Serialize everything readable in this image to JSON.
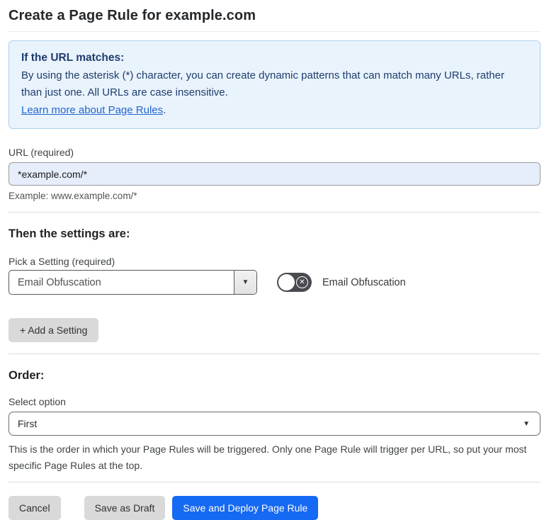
{
  "page": {
    "title": "Create a Page Rule for example.com"
  },
  "url_section": {
    "callout": {
      "heading": "If the URL matches:",
      "body": "By using the asterisk (*) character, you can create dynamic patterns that can match many URLs, rather than just one. All URLs are case insensitive.",
      "link_label": "Learn more about Page Rules",
      "link_suffix": "."
    },
    "url_label": "URL (required)",
    "url_value": "*example.com/*",
    "example_text": "Example: www.example.com/*"
  },
  "settings_section": {
    "heading": "Then the settings are:",
    "pick_label": "Pick a Setting (required)",
    "selected_setting": "Email Obfuscation",
    "toggle_label": "Email Obfuscation",
    "toggle_state": "off",
    "add_setting_label": "+ Add a Setting"
  },
  "order_section": {
    "heading": "Order:",
    "select_label": "Select option",
    "selected_option": "First",
    "help_text": "This is the order in which your Page Rules will be triggered. Only one Page Rule will trigger per URL, so put your most specific Page Rules at the top."
  },
  "footer": {
    "cancel_label": "Cancel",
    "save_draft_label": "Save as Draft",
    "save_deploy_label": "Save and Deploy Page Rule"
  },
  "icons": {
    "dropdown_arrow": "▼",
    "toggle_x": "✕"
  },
  "colors": {
    "callout_bg": "#e9f3fc",
    "callout_border": "#abd0ef",
    "callout_text": "#1f3d6d",
    "link": "#2366cc",
    "url_input_bg": "#e6eefc",
    "primary_button": "#1669f2",
    "gray_button": "#d9d9d9",
    "toggle_off": "#4a4b50"
  }
}
